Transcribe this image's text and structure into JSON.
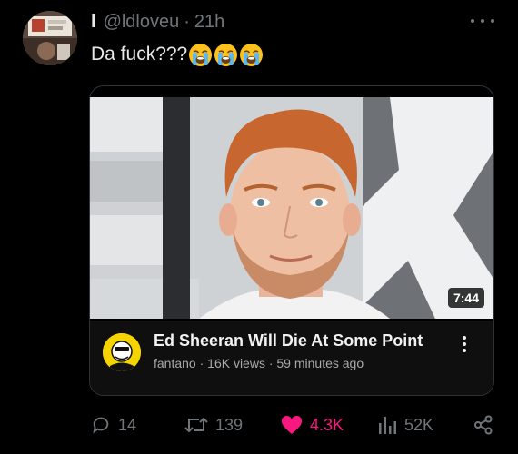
{
  "tweet": {
    "display_name": "l",
    "handle": "@ldloveu",
    "separator": "·",
    "time": "21h",
    "text": "Da fuck???",
    "emojis": [
      "loudly-crying-face-emoji",
      "loudly-crying-face-emoji",
      "loudly-crying-face-emoji"
    ]
  },
  "video_card": {
    "duration": "7:44",
    "title": "Ed Sheeran Will Die At Some Point",
    "meta": "fantano · 16K views · 59 minutes ago"
  },
  "actions": {
    "replies": "14",
    "retweets": "139",
    "likes": "4.3K",
    "views": "52K"
  },
  "colors": {
    "background": "#000000",
    "text_primary": "#e7e9ea",
    "text_secondary": "#71767b",
    "like_pink": "#f91880",
    "card_border": "#2f3336",
    "channel_avatar_yellow": "#f5d400"
  },
  "icons": [
    "more-icon",
    "reply-icon",
    "retweet-icon",
    "like-icon",
    "views-icon",
    "share-icon",
    "kebab-menu-icon"
  ]
}
